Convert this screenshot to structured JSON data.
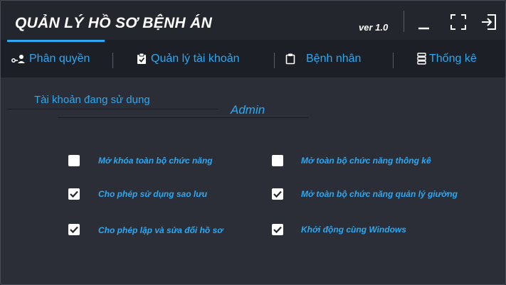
{
  "titlebar": {
    "title": "QUẢN LÝ HỒ SƠ BỆNH ÁN",
    "version": "ver 1.0",
    "buttons": [
      "minimize-icon",
      "fullscreen-icon",
      "exit-icon"
    ]
  },
  "tabs": [
    {
      "label": "Phân quyền",
      "icon": "user-key-icon",
      "active": true
    },
    {
      "label": "Quản lý tài khoản",
      "icon": "clipboard-check-icon",
      "active": false
    },
    {
      "label": "Bệnh nhân",
      "icon": "clipboard-icon",
      "active": false
    },
    {
      "label": "Thống kê",
      "icon": "server-icon",
      "active": false
    }
  ],
  "account": {
    "label": "Tài khoản đang sử dụng",
    "value": "Admin"
  },
  "options": [
    {
      "label": "Mở khóa toàn bộ chức năng",
      "checked": false
    },
    {
      "label": "Mở toàn bộ chức năng thông kê",
      "checked": false
    },
    {
      "label": "Cho phép sử dụng sao lưu",
      "checked": true
    },
    {
      "label": "Mở toàn bộ chức năng quản lý giường",
      "checked": true
    },
    {
      "label": "Cho phép lập và sửa đổi hồ sơ",
      "checked": true
    },
    {
      "label": "Khởi động cùng Windows",
      "checked": true
    }
  ],
  "colors": {
    "accent": "#2ea8f2",
    "background": "#2b2e36",
    "titlebar": "#23262d",
    "tabbar": "#1c1f26"
  }
}
